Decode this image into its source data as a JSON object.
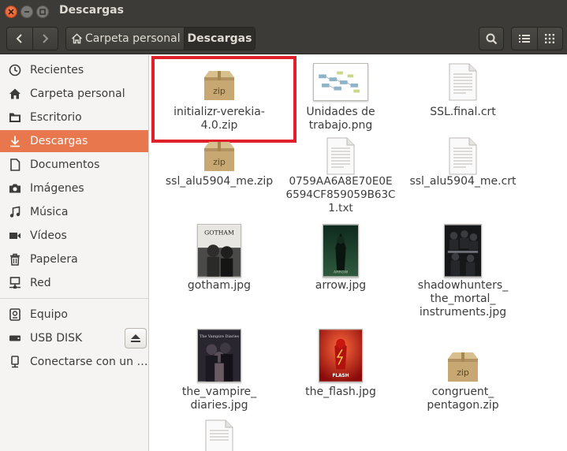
{
  "window": {
    "title": "Descargas"
  },
  "pathbar": {
    "home": "Carpeta personal",
    "current": "Descargas"
  },
  "sidebar": {
    "items": [
      {
        "label": "Recientes",
        "icon": "clock-icon"
      },
      {
        "label": "Carpeta personal",
        "icon": "home-icon"
      },
      {
        "label": "Escritorio",
        "icon": "folder-icon"
      },
      {
        "label": "Descargas",
        "icon": "download-icon",
        "selected": true
      },
      {
        "label": "Documentos",
        "icon": "document-icon"
      },
      {
        "label": "Imágenes",
        "icon": "camera-icon"
      },
      {
        "label": "Música",
        "icon": "music-icon"
      },
      {
        "label": "Vídeos",
        "icon": "video-icon"
      },
      {
        "label": "Papelera",
        "icon": "trash-icon"
      },
      {
        "label": "Red",
        "icon": "network-icon"
      }
    ],
    "devices": [
      {
        "label": "Equipo",
        "icon": "computer-icon"
      },
      {
        "label": "USB DISK",
        "icon": "usb-drive-icon"
      },
      {
        "label": "Conectarse con un …",
        "icon": "server-icon"
      }
    ]
  },
  "files": [
    {
      "name": "initializr-verekia-4.0.zip",
      "line1": "initializr-verekia-",
      "line2": "4.0.zip",
      "type": "zip",
      "highlighted": true
    },
    {
      "name": "Unidades de trabajo.png",
      "line1": "Unidades de",
      "line2": "trabajo.png",
      "type": "png-diagram"
    },
    {
      "name": "SSL.final.crt",
      "line1": "SSL.final.crt",
      "type": "document"
    },
    {
      "name": "ssl_alu5904_me.zip",
      "line1": "ssl_alu5904_me.zip",
      "type": "zip"
    },
    {
      "name": "0759AA6A8E70E0E6594CF859059B63C1.txt",
      "line1": "0759AA6A8E70E0E",
      "line2": "6594CF859059B63C",
      "line3": "1.txt",
      "type": "document"
    },
    {
      "name": "ssl_alu5904_me.crt",
      "line1": "ssl_alu5904_me.crt",
      "type": "document"
    },
    {
      "name": "gotham.jpg",
      "line1": "gotham.jpg",
      "type": "poster",
      "poster_text": "GOTHAM"
    },
    {
      "name": "arrow.jpg",
      "line1": "arrow.jpg",
      "type": "poster",
      "poster_text": "ARROW"
    },
    {
      "name": "shadowhunters_the_mortal_instruments.jpg",
      "line1": "shadowhunters_",
      "line2": "the_mortal_",
      "line3": "instruments.jpg",
      "type": "poster"
    },
    {
      "name": "the_vampire_diaries.jpg",
      "line1": "the_vampire_",
      "line2": "diaries.jpg",
      "type": "poster",
      "poster_text": "The Vampire Diaries"
    },
    {
      "name": "the_flash.jpg",
      "line1": "the_flash.jpg",
      "type": "poster",
      "poster_text": "FLASH"
    },
    {
      "name": "congruent_pentagon.zip",
      "line1": "congruent_",
      "line2": "pentagon.zip",
      "type": "zip"
    }
  ],
  "colors": {
    "accent": "#e9774e",
    "highlight_border": "#e0202a",
    "titlebar": "#3c3b37"
  }
}
